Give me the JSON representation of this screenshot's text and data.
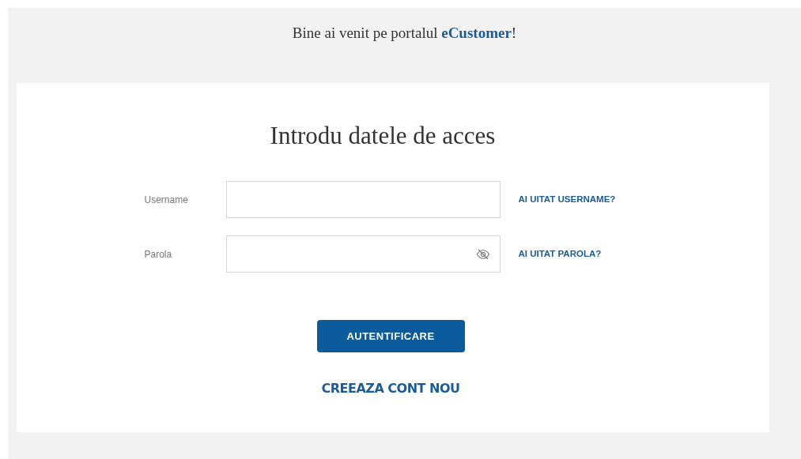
{
  "welcome": {
    "text": "Bine ai venit pe portalul **eCustomer**!"
  },
  "card": {
    "title": "Introdu datele de acces",
    "fields": [
      {
        "kind": "text",
        "label": "Username",
        "link": "AI UITAT USERNAME?"
      },
      {
        "kind": "password",
        "label": "Parola",
        "link": "AI UITAT PAROLA?"
      }
    ],
    "submit": "AUTENTIFICARE",
    "create_account": "CREEAZA CONT NOU"
  }
}
